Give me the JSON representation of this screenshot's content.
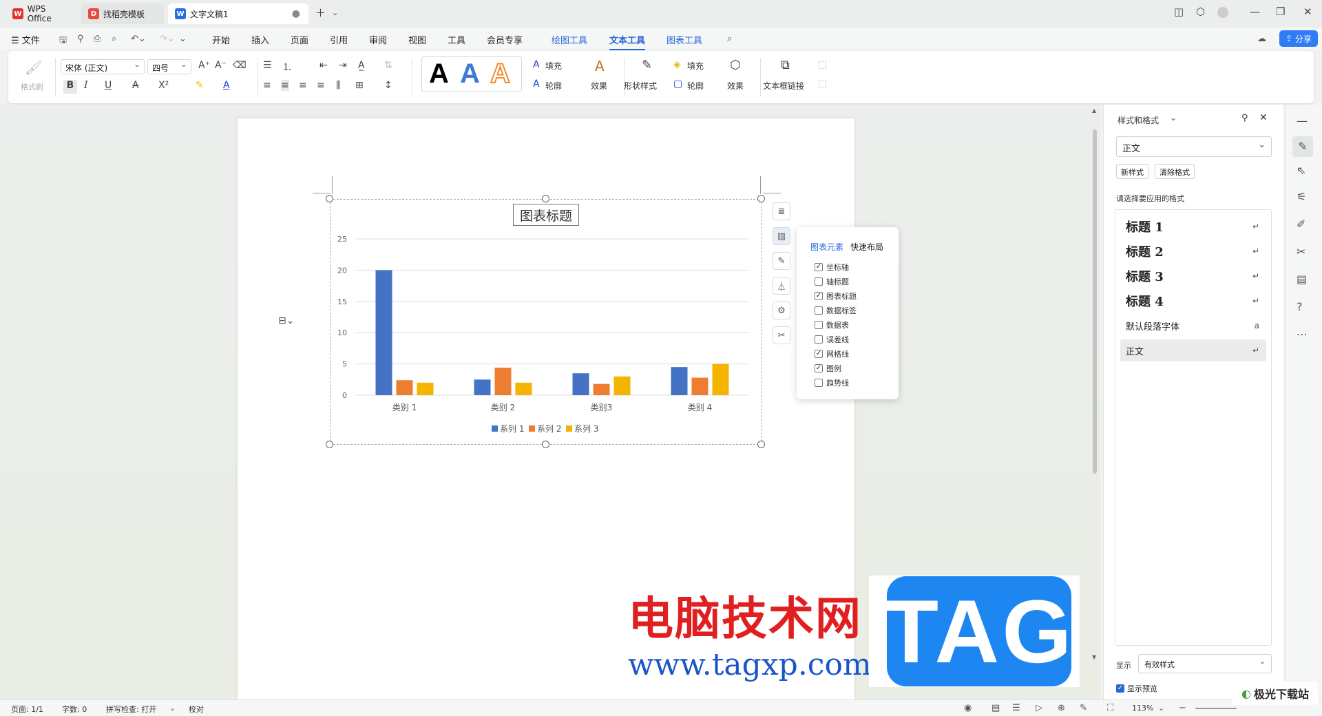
{
  "tabs": [
    {
      "label": "WPS Office",
      "icon": "wps-logo-icon"
    },
    {
      "label": "找稻壳模板",
      "icon": "docer-icon"
    },
    {
      "label": "文字文稿1",
      "icon": "word-doc-icon"
    }
  ],
  "menu": {
    "file": "文件",
    "items": [
      "开始",
      "插入",
      "页面",
      "引用",
      "审阅",
      "视图",
      "工具",
      "会员专享"
    ],
    "context_tabs": [
      "绘图工具",
      "文本工具",
      "图表工具"
    ],
    "active": "文本工具",
    "share": "分享"
  },
  "ribbon": {
    "format_painter": "格式刷",
    "font_name": "宋体 (正文)",
    "font_size": "四号",
    "wordart_fill": "填充",
    "wordart_outline": "轮廓",
    "text_effect": "效果",
    "shape_style": "形状样式",
    "shape_fill": "填充",
    "shape_outline": "轮廓",
    "shape_effect": "效果",
    "textbox_link": "文本框链接",
    "bold": "B",
    "italic": "I",
    "underline": "U"
  },
  "chart_data": {
    "type": "bar",
    "title": "图表标题",
    "categories": [
      "类别 1",
      "类别 2",
      "类别3",
      "类别 4"
    ],
    "series": [
      {
        "name": "系列 1",
        "values": [
          20,
          2.5,
          3.5,
          4.5
        ],
        "color": "#4472c4"
      },
      {
        "name": "系列 2",
        "values": [
          2.4,
          4.4,
          1.8,
          2.8
        ],
        "color": "#ed7d31"
      },
      {
        "name": "系列 3",
        "values": [
          2,
          2,
          3,
          5
        ],
        "color": "#f4b400"
      }
    ],
    "yticks": [
      "0",
      "5",
      "10",
      "15",
      "20",
      "25"
    ],
    "ylim": [
      0,
      25
    ],
    "grid": true,
    "legend": "bottom"
  },
  "chart_elements_popup": {
    "tab_elements": "图表元素",
    "tab_layout": "快速布局",
    "options": [
      {
        "label": "坐标轴",
        "checked": true
      },
      {
        "label": "轴标题",
        "checked": false
      },
      {
        "label": "图表标题",
        "checked": true
      },
      {
        "label": "数据标签",
        "checked": false
      },
      {
        "label": "数据表",
        "checked": false
      },
      {
        "label": "误差线",
        "checked": false
      },
      {
        "label": "网格线",
        "checked": true
      },
      {
        "label": "图例",
        "checked": true
      },
      {
        "label": "趋势线",
        "checked": false
      }
    ]
  },
  "watermark": {
    "text_cn": "电脑技术网",
    "url": "www.tagxp.com",
    "tag": "TAG",
    "corner": "极光下载站"
  },
  "panel": {
    "title": "样式和格式",
    "current_style": "正文",
    "new_style": "新样式",
    "clear_format": "清除格式",
    "prompt": "请选择要应用的格式",
    "styles": [
      {
        "label": "标题  1",
        "kind": "heading"
      },
      {
        "label": "标题  2",
        "kind": "heading"
      },
      {
        "label": "标题  3",
        "kind": "heading"
      },
      {
        "label": "标题 4",
        "kind": "heading"
      },
      {
        "label": "默认段落字体",
        "kind": "plain"
      },
      {
        "label": "正文",
        "kind": "selected"
      }
    ],
    "show_label": "显示",
    "show_value": "有效样式",
    "preview_label": "显示预览",
    "preview_checked": true
  },
  "status": {
    "page": "页面: 1/1",
    "words": "字数: 0",
    "spell": "拼写检查: 打开",
    "proof": "校对",
    "zoom": "113%"
  },
  "colors": {
    "accent": "#2866d8",
    "share_bg": "#2f7cf6",
    "tag_bg": "#1e86f0",
    "watermark_red": "#e02020"
  }
}
